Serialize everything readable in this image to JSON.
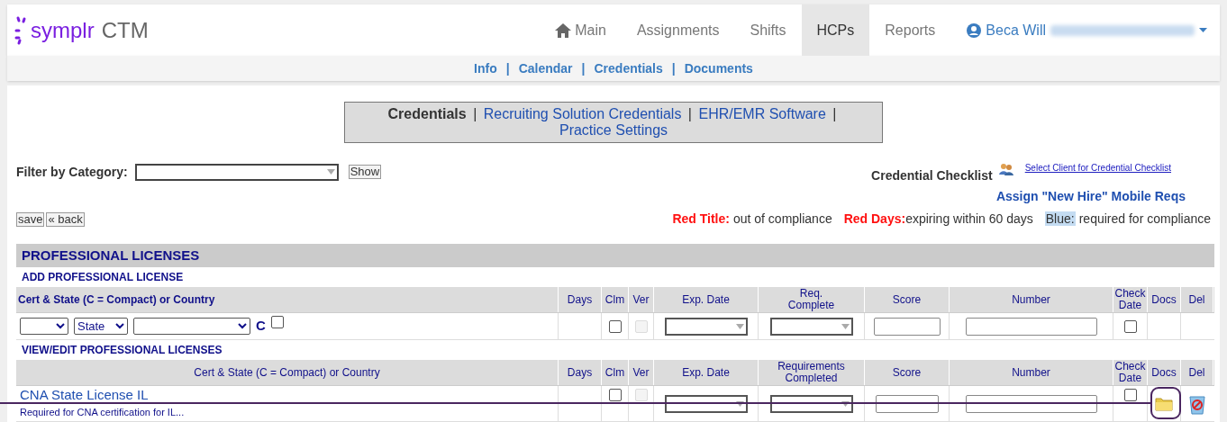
{
  "header": {
    "logo": {
      "brand": "symplr",
      "product": "CTM"
    },
    "nav": [
      {
        "label": "Main",
        "kind": "home",
        "selected": false
      },
      {
        "label": "Assignments",
        "kind": "plain",
        "selected": false
      },
      {
        "label": "Shifts",
        "kind": "plain",
        "selected": false
      },
      {
        "label": "HCPs",
        "kind": "plain",
        "selected": true
      },
      {
        "label": "Reports",
        "kind": "plain",
        "selected": false
      }
    ],
    "user": {
      "name": "Beca Will"
    }
  },
  "subnav": {
    "separator": "|",
    "items": [
      "Info",
      "Calendar",
      "Credentials",
      "Documents"
    ]
  },
  "credential_tabs": {
    "separator": "|",
    "items": [
      {
        "label": "Credentials",
        "selected": true
      },
      {
        "label": "Recruiting Solution Credentials",
        "selected": false
      },
      {
        "label": "EHR/EMR Software",
        "selected": false
      },
      {
        "label": "Practice Settings",
        "selected": false
      }
    ]
  },
  "filter": {
    "label": "Filter by Category:",
    "button": "Show"
  },
  "checklist": {
    "title": "Credential Checklist",
    "link": "Select Client for Credential Checklist",
    "assign": "Assign \"New Hire\" Mobile Reqs"
  },
  "actions": [
    "save",
    "« back"
  ],
  "legend": [
    {
      "term": "Red Title:",
      "text": "out of compliance",
      "kind": "red"
    },
    {
      "term": "Red Days:",
      "text": "expiring within 60 days",
      "kind": "red"
    },
    {
      "term": "Blue:",
      "text": "required for compliance",
      "kind": "blue"
    }
  ],
  "section": {
    "title": "PROFESSIONAL LICENSES",
    "add_title": "ADD PROFESSIONAL LICENSE",
    "add_columns": [
      "Cert & State (C = Compact) or Country",
      "Days",
      "Clm",
      "Ver",
      "Exp. Date",
      "Req. Complete",
      "Score",
      "Number",
      "Check Date",
      "Docs",
      "Del"
    ],
    "add_row": {
      "selects": [
        {
          "kind": "blank"
        },
        {
          "kind": "state",
          "value": "State"
        },
        {
          "kind": "blank"
        }
      ],
      "compact_label": "C",
      "compact_checked": false,
      "clm_checked": false,
      "ver_disabled": true,
      "check_date_checked": false
    },
    "view_title": "VIEW/EDIT PROFESSIONAL LICENSES",
    "view_columns": [
      "Cert & State (C = Compact) or Country",
      "Days",
      "Clm",
      "Ver",
      "Exp. Date",
      "Requirements Completed",
      "Score",
      "Number",
      "Check Date",
      "Docs",
      "Del"
    ],
    "rows": [
      {
        "name": "CNA State License IL",
        "note": "Required for CNA certification for IL...",
        "clm_checked": false,
        "ver_disabled": true,
        "check_date_checked": false
      }
    ]
  }
}
